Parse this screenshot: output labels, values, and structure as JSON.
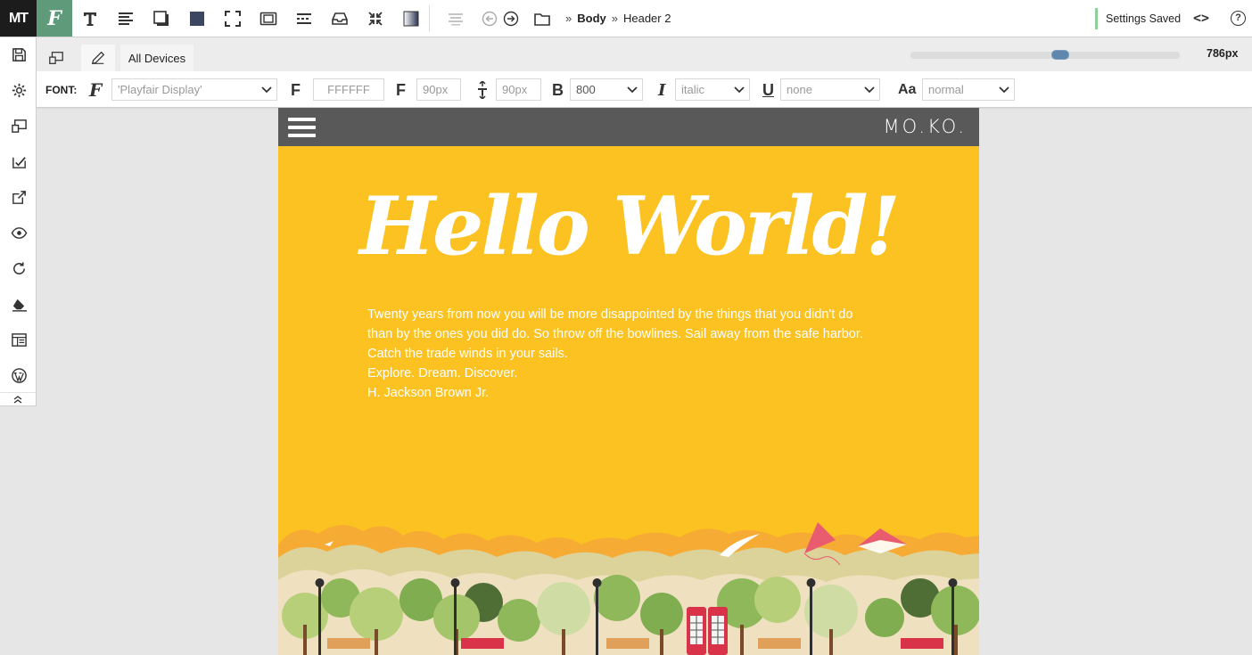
{
  "app": {
    "logo": "MT",
    "font_tool_glyph": "F"
  },
  "toolbar": {
    "tools": [
      "text-tool",
      "align-tool",
      "shadow-tool",
      "background-tool",
      "fullscreen-tool",
      "padding-tool",
      "spacing-tool",
      "inbox-tool",
      "compress-tool",
      "gradient-tool"
    ],
    "breadcrumb": {
      "root": "Body",
      "separator": "»",
      "current": "Header 2"
    },
    "status": "Settings Saved"
  },
  "devices": {
    "tab_label": "All Devices",
    "width_label": "786px",
    "width_fraction": 0.56
  },
  "font_panel": {
    "label": "FONT:",
    "family": "'Playfair Display'",
    "color": "FFFFFF",
    "font_size": "90px",
    "line_height": "90px",
    "weight": "800",
    "style": "italic",
    "decoration": "none",
    "transform": "normal",
    "icons": {
      "color": "F",
      "size": "F",
      "bold": "B",
      "italic": "I",
      "underline": "U",
      "transform": "Aa"
    }
  },
  "site": {
    "brand": "MO.KO.",
    "hero_title": "Hello World!",
    "quote_lines": [
      "Twenty years from now you will be more disappointed by the things that you didn't do",
      "than by the ones you did do. So throw off the bowlines. Sail away from the safe harbor.",
      "Catch the trade winds in your sails.",
      "Explore. Dream. Discover.",
      "H. Jackson Brown Jr."
    ]
  },
  "colors": {
    "accent_green": "#5f9b7a",
    "hero_yellow": "#fcc222",
    "nav_gray": "#595959",
    "slider_blue": "#5f86ad"
  }
}
